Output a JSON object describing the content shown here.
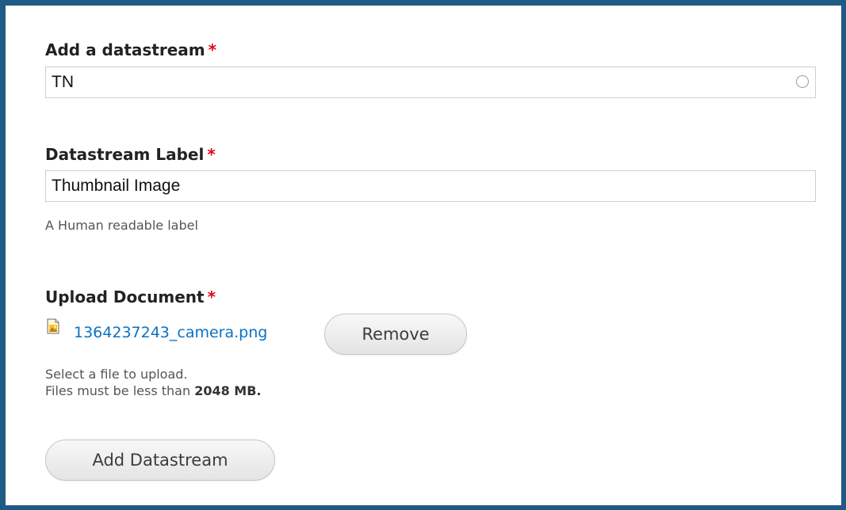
{
  "form": {
    "datastream": {
      "label": "Add a datastream",
      "required_marker": "*",
      "value": "TN"
    },
    "datastream_label": {
      "label": "Datastream Label",
      "required_marker": "*",
      "value": "Thumbnail Image",
      "description": "A Human readable label"
    },
    "upload": {
      "label": "Upload Document",
      "required_marker": "*",
      "file_name": "1364237243_camera.png",
      "remove_label": "Remove",
      "help_line1": "Select a file to upload.",
      "help_line2_prefix": "Files must be less than",
      "help_line2_limit": "2048 MB."
    },
    "submit_label": "Add Datastream"
  },
  "colors": {
    "frame_border": "#1f5a85",
    "required": "#e0081a",
    "link": "#0a72c2"
  },
  "icons": {
    "throbber": "autocomplete-throbber-icon",
    "file": "image-file-icon"
  }
}
